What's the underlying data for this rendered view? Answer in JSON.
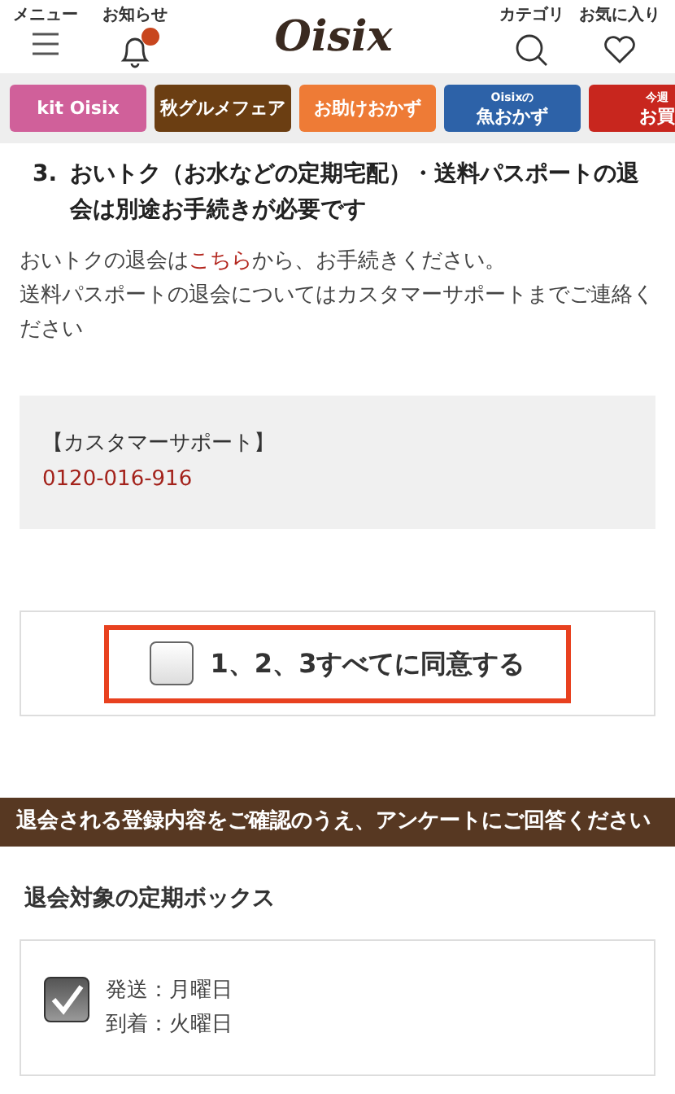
{
  "header": {
    "menu_label": "メニュー",
    "notice_label": "お知らせ",
    "notice_unread": true,
    "logo": "Oisix",
    "category_label": "カテゴリ",
    "favorites_label": "お気に入り"
  },
  "banners": [
    {
      "lines": [
        "kit Oisix"
      ],
      "color": "#d0609a"
    },
    {
      "lines": [
        "秋グルメフェア"
      ],
      "color": "#6b3e12"
    },
    {
      "lines": [
        "お助けおかず"
      ],
      "color": "#ee7b36"
    },
    {
      "lines": [
        "Oisixの",
        "魚おかず"
      ],
      "color": "#2d62a8"
    },
    {
      "lines": [
        "今週",
        "お買"
      ],
      "color": "#c8261e"
    }
  ],
  "notice": {
    "number": "3.",
    "heading": "おいトク（お水などの定期宅配）・送料パスポートの退会は別途お手続きが必要です",
    "body_before": "おいトクの退会は",
    "link": "こちら",
    "body_after": "から、お手続きください。",
    "body2": "送料パスポートの退会についてはカスタマーサポートまでご連絡ください"
  },
  "support": {
    "title": "【カスタマーサポート】",
    "phone": "0120-016-916"
  },
  "agree": {
    "label": "1、2、3すべてに同意する",
    "checked": false
  },
  "section_bar": "退会される登録内容をご確認のうえ、アンケートにご回答ください",
  "box_heading": "退会対象の定期ボックス",
  "boxes": [
    {
      "checked": true,
      "lines": [
        "発送：月曜日",
        "到着：火曜日"
      ]
    }
  ]
}
